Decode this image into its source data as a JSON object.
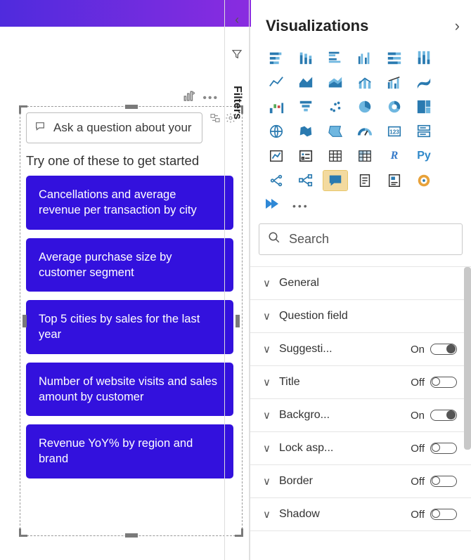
{
  "canvas": {
    "qna_placeholder": "Ask a question about your data",
    "subheading": "Try one of these to get started",
    "suggestions": [
      "Cancellations and average revenue per transaction by city",
      "Average purchase size by customer segment",
      "Top 5 cities by sales for the last year",
      "Number of website visits and sales amount by customer",
      "Revenue YoY% by region and brand"
    ]
  },
  "filtersPane": {
    "label": "Filters"
  },
  "vizPane": {
    "title": "Visualizations",
    "search_placeholder": "Search",
    "gallery": [
      {
        "name": "stacked-bar",
        "selected": false
      },
      {
        "name": "stacked-column",
        "selected": false
      },
      {
        "name": "clustered-bar",
        "selected": false
      },
      {
        "name": "clustered-column",
        "selected": false
      },
      {
        "name": "100-stacked-bar",
        "selected": false
      },
      {
        "name": "100-stacked-column",
        "selected": false
      },
      {
        "name": "line",
        "selected": false
      },
      {
        "name": "area",
        "selected": false
      },
      {
        "name": "stacked-area",
        "selected": false
      },
      {
        "name": "line-stacked-column",
        "selected": false
      },
      {
        "name": "line-clustered-column",
        "selected": false
      },
      {
        "name": "ribbon",
        "selected": false
      },
      {
        "name": "waterfall",
        "selected": false
      },
      {
        "name": "funnel",
        "selected": false
      },
      {
        "name": "scatter",
        "selected": false
      },
      {
        "name": "pie",
        "selected": false
      },
      {
        "name": "donut",
        "selected": false
      },
      {
        "name": "treemap",
        "selected": false
      },
      {
        "name": "map",
        "selected": false
      },
      {
        "name": "filled-map",
        "selected": false
      },
      {
        "name": "shape-map",
        "selected": false
      },
      {
        "name": "gauge",
        "selected": false
      },
      {
        "name": "card",
        "selected": false
      },
      {
        "name": "multi-row-card",
        "selected": false
      },
      {
        "name": "kpi",
        "selected": false
      },
      {
        "name": "slicer",
        "selected": false
      },
      {
        "name": "table",
        "selected": false
      },
      {
        "name": "matrix",
        "selected": false
      },
      {
        "name": "r-visual",
        "selected": false,
        "text": "R"
      },
      {
        "name": "python-visual",
        "selected": false,
        "text": "Py"
      },
      {
        "name": "key-influencers",
        "selected": false
      },
      {
        "name": "decomposition-tree",
        "selected": false
      },
      {
        "name": "qna-visual",
        "selected": true
      },
      {
        "name": "paginated",
        "selected": false
      },
      {
        "name": "smart-narrative",
        "selected": false
      },
      {
        "name": "arcgis",
        "selected": false
      },
      {
        "name": "power-apps",
        "selected": false
      },
      {
        "name": "power-automate",
        "selected": false
      }
    ],
    "format_groups": [
      {
        "label": "General",
        "toggle": null
      },
      {
        "label": "Question field",
        "toggle": null
      },
      {
        "label": "Suggesti...",
        "toggle": "On"
      },
      {
        "label": "Title",
        "toggle": "Off"
      },
      {
        "label": "Backgro...",
        "toggle": "On"
      },
      {
        "label": "Lock asp...",
        "toggle": "Off"
      },
      {
        "label": "Border",
        "toggle": "Off"
      },
      {
        "label": "Shadow",
        "toggle": "Off"
      }
    ]
  }
}
